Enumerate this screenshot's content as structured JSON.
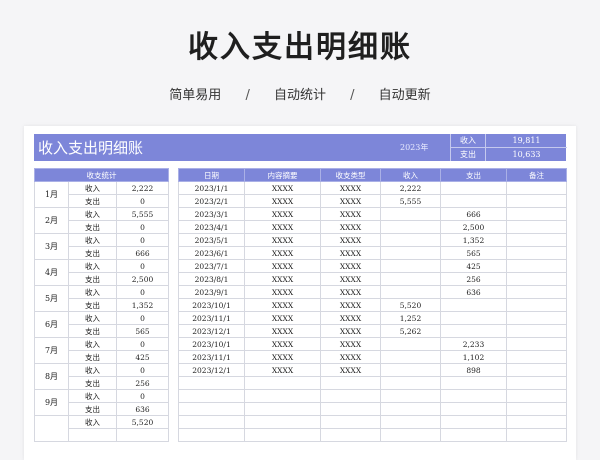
{
  "hero": {
    "title": "收入支出明细账",
    "tags": [
      "简单易用",
      "自动统计",
      "自动更新"
    ],
    "separator": "/"
  },
  "sheet": {
    "title": "收入支出明细账",
    "year": "2023年",
    "summary": [
      {
        "label": "收入",
        "value": "19,811"
      },
      {
        "label": "支出",
        "value": "10,633"
      }
    ],
    "stats": {
      "header": "收支统计",
      "months": [
        {
          "month": "1月",
          "income_label": "收入",
          "income": "2,222",
          "expense_label": "支出",
          "expense": "0"
        },
        {
          "month": "2月",
          "income_label": "收入",
          "income": "5,555",
          "expense_label": "支出",
          "expense": "0"
        },
        {
          "month": "3月",
          "income_label": "收入",
          "income": "0",
          "expense_label": "支出",
          "expense": "666"
        },
        {
          "month": "4月",
          "income_label": "收入",
          "income": "0",
          "expense_label": "支出",
          "expense": "2,500"
        },
        {
          "month": "5月",
          "income_label": "收入",
          "income": "0",
          "expense_label": "支出",
          "expense": "1,352"
        },
        {
          "month": "6月",
          "income_label": "收入",
          "income": "0",
          "expense_label": "支出",
          "expense": "565"
        },
        {
          "month": "7月",
          "income_label": "收入",
          "income": "0",
          "expense_label": "支出",
          "expense": "425"
        },
        {
          "month": "8月",
          "income_label": "收入",
          "income": "0",
          "expense_label": "支出",
          "expense": "256"
        },
        {
          "month": "9月",
          "income_label": "收入",
          "income": "0",
          "expense_label": "支出",
          "expense": "636"
        },
        {
          "month": "",
          "income_label": "收入",
          "income": "5,520",
          "expense_label": "",
          "expense": ""
        }
      ]
    },
    "ledger": {
      "headers": [
        "日期",
        "内容摘要",
        "收支类型",
        "收入",
        "支出",
        "备注"
      ],
      "rows": [
        [
          "2023/1/1",
          "XXXX",
          "XXXX",
          "2,222",
          "",
          ""
        ],
        [
          "2023/2/1",
          "XXXX",
          "XXXX",
          "5,555",
          "",
          ""
        ],
        [
          "2023/3/1",
          "XXXX",
          "XXXX",
          "",
          "666",
          ""
        ],
        [
          "2023/4/1",
          "XXXX",
          "XXXX",
          "",
          "2,500",
          ""
        ],
        [
          "2023/5/1",
          "XXXX",
          "XXXX",
          "",
          "1,352",
          ""
        ],
        [
          "2023/6/1",
          "XXXX",
          "XXXX",
          "",
          "565",
          ""
        ],
        [
          "2023/7/1",
          "XXXX",
          "XXXX",
          "",
          "425",
          ""
        ],
        [
          "2023/8/1",
          "XXXX",
          "XXXX",
          "",
          "256",
          ""
        ],
        [
          "2023/9/1",
          "XXXX",
          "XXXX",
          "",
          "636",
          ""
        ],
        [
          "2023/10/1",
          "XXXX",
          "XXXX",
          "5,520",
          "",
          ""
        ],
        [
          "2023/11/1",
          "XXXX",
          "XXXX",
          "1,252",
          "",
          ""
        ],
        [
          "2023/12/1",
          "XXXX",
          "XXXX",
          "5,262",
          "",
          ""
        ],
        [
          "2023/10/1",
          "XXXX",
          "XXXX",
          "",
          "2,233",
          ""
        ],
        [
          "2023/11/1",
          "XXXX",
          "XXXX",
          "",
          "1,102",
          ""
        ],
        [
          "2023/12/1",
          "XXXX",
          "XXXX",
          "",
          "898",
          ""
        ],
        [
          "",
          "",
          "",
          "",
          "",
          ""
        ],
        [
          "",
          "",
          "",
          "",
          "",
          ""
        ],
        [
          "",
          "",
          "",
          "",
          "",
          ""
        ],
        [
          "",
          "",
          "",
          "",
          "",
          ""
        ],
        [
          "",
          "",
          "",
          "",
          "",
          ""
        ]
      ]
    }
  },
  "colors": {
    "accent": "#7d86d9",
    "grid": "#d6d8e0",
    "background": "#f5f5f7"
  }
}
